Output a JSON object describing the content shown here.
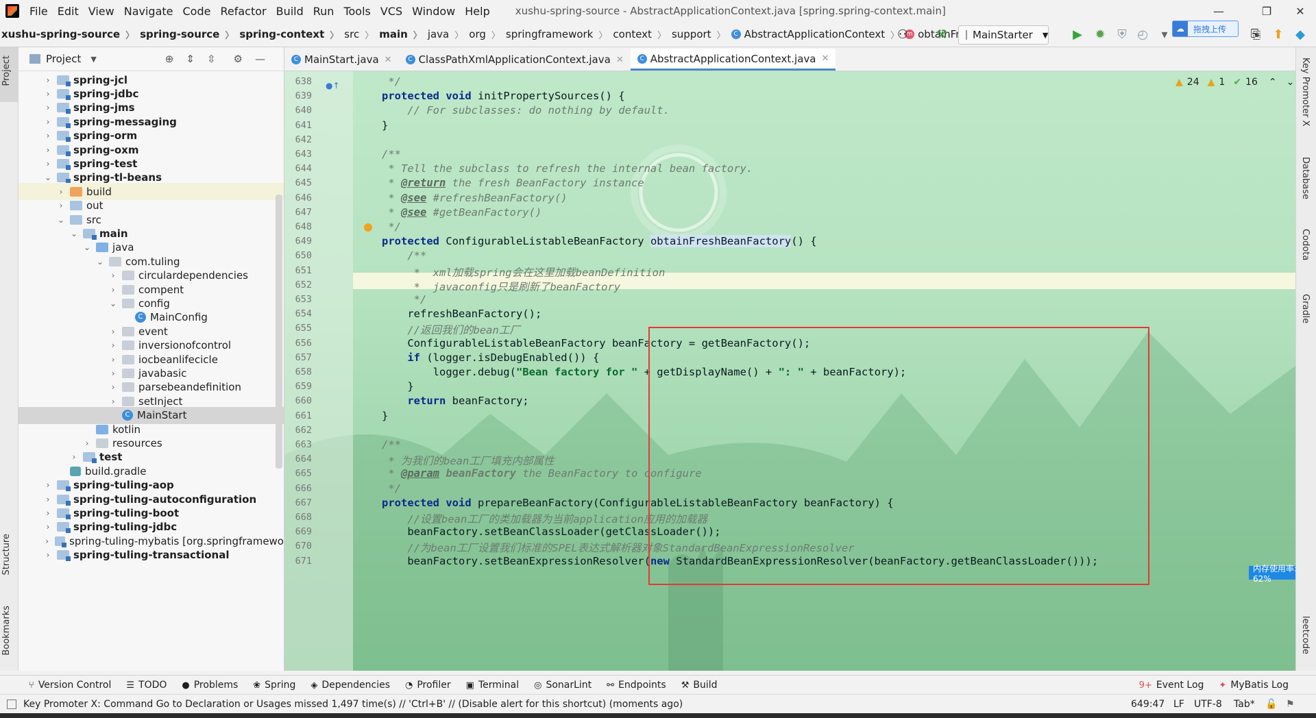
{
  "window": {
    "title": "xushu-spring-source - AbstractApplicationContext.java [spring.spring-context.main]",
    "menu": [
      "File",
      "Edit",
      "View",
      "Navigate",
      "Code",
      "Refactor",
      "Build",
      "Run",
      "Tools",
      "VCS",
      "Window",
      "Help"
    ],
    "menu_mnemonic": [
      "F",
      "E",
      "V",
      "N",
      "C",
      "R",
      "B",
      "R",
      "T",
      "V",
      "W",
      "H"
    ]
  },
  "breadcrumb": [
    {
      "label": "xushu-spring-source",
      "bold": true
    },
    {
      "label": "spring-source",
      "bold": true
    },
    {
      "label": "spring-context",
      "bold": true
    },
    {
      "label": "src",
      "bold": false
    },
    {
      "label": "main",
      "bold": true
    },
    {
      "label": "java",
      "bold": false
    },
    {
      "label": "org",
      "bold": false
    },
    {
      "label": "springframework",
      "bold": false
    },
    {
      "label": "context",
      "bold": false
    },
    {
      "label": "support",
      "bold": false
    },
    {
      "label": "AbstractApplicationContext",
      "bold": false
    },
    {
      "label": "obtainFreshBeanFactory",
      "bold": false
    }
  ],
  "toolbar": {
    "run_config": "MainStarter",
    "upload_badge": "拖拽上传"
  },
  "project": {
    "title": "Project",
    "tree": [
      {
        "label": "spring-jcl",
        "depth": 0,
        "chev": "right",
        "icon": "module",
        "bold": true
      },
      {
        "label": "spring-jdbc",
        "depth": 0,
        "chev": "right",
        "icon": "module",
        "bold": true
      },
      {
        "label": "spring-jms",
        "depth": 0,
        "chev": "right",
        "icon": "module",
        "bold": true
      },
      {
        "label": "spring-messaging",
        "depth": 0,
        "chev": "right",
        "icon": "module",
        "bold": true
      },
      {
        "label": "spring-orm",
        "depth": 0,
        "chev": "right",
        "icon": "module",
        "bold": true
      },
      {
        "label": "spring-oxm",
        "depth": 0,
        "chev": "right",
        "icon": "module",
        "bold": true
      },
      {
        "label": "spring-test",
        "depth": 0,
        "chev": "right",
        "icon": "module",
        "bold": true
      },
      {
        "label": "spring-tl-beans",
        "depth": 0,
        "chev": "down",
        "icon": "module",
        "bold": true
      },
      {
        "label": "build",
        "depth": 1,
        "chev": "right",
        "icon": "orange",
        "bold": false,
        "hl": true
      },
      {
        "label": "out",
        "depth": 1,
        "chev": "right",
        "icon": "folder",
        "bold": false
      },
      {
        "label": "src",
        "depth": 1,
        "chev": "down",
        "icon": "folder",
        "bold": false
      },
      {
        "label": "main",
        "depth": 2,
        "chev": "down",
        "icon": "module",
        "bold": true
      },
      {
        "label": "java",
        "depth": 3,
        "chev": "down",
        "icon": "blue",
        "bold": false
      },
      {
        "label": "com.tuling",
        "depth": 4,
        "chev": "down",
        "icon": "pkg",
        "bold": false
      },
      {
        "label": "circulardependencies",
        "depth": 5,
        "chev": "right",
        "icon": "pkg",
        "bold": false
      },
      {
        "label": "compent",
        "depth": 5,
        "chev": "right",
        "icon": "pkg",
        "bold": false
      },
      {
        "label": "config",
        "depth": 5,
        "chev": "down",
        "icon": "pkg",
        "bold": false
      },
      {
        "label": "MainConfig",
        "depth": 6,
        "chev": "none",
        "icon": "class",
        "bold": false
      },
      {
        "label": "event",
        "depth": 5,
        "chev": "right",
        "icon": "pkg",
        "bold": false
      },
      {
        "label": "inversionofcontrol",
        "depth": 5,
        "chev": "right",
        "icon": "pkg",
        "bold": false
      },
      {
        "label": "iocbeanlifecicle",
        "depth": 5,
        "chev": "right",
        "icon": "pkg",
        "bold": false
      },
      {
        "label": "javabasic",
        "depth": 5,
        "chev": "right",
        "icon": "pkg",
        "bold": false
      },
      {
        "label": "parsebeandefinition",
        "depth": 5,
        "chev": "right",
        "icon": "pkg",
        "bold": false
      },
      {
        "label": "setInject",
        "depth": 5,
        "chev": "right",
        "icon": "pkg",
        "bold": false
      },
      {
        "label": "MainStart",
        "depth": 5,
        "chev": "none",
        "icon": "class",
        "bold": false,
        "sel": true
      },
      {
        "label": "kotlin",
        "depth": 3,
        "chev": "none",
        "icon": "blue",
        "bold": false
      },
      {
        "label": "resources",
        "depth": 3,
        "chev": "right",
        "icon": "pkg",
        "bold": false
      },
      {
        "label": "test",
        "depth": 2,
        "chev": "right",
        "icon": "module",
        "bold": true
      },
      {
        "label": "build.gradle",
        "depth": 1,
        "chev": "none",
        "icon": "gradle",
        "bold": false
      },
      {
        "label": "spring-tuling-aop",
        "depth": 0,
        "chev": "right",
        "icon": "module",
        "bold": true
      },
      {
        "label": "spring-tuling-autoconfiguration",
        "depth": 0,
        "chev": "right",
        "icon": "module",
        "bold": true
      },
      {
        "label": "spring-tuling-boot",
        "depth": 0,
        "chev": "right",
        "icon": "module",
        "bold": true
      },
      {
        "label": "spring-tuling-jdbc",
        "depth": 0,
        "chev": "right",
        "icon": "module",
        "bold": true
      },
      {
        "label": "spring-tuling-mybatis [org.springframewo",
        "depth": 0,
        "chev": "right",
        "icon": "module",
        "bold": false
      },
      {
        "label": "spring-tuling-transactional",
        "depth": 0,
        "chev": "right",
        "icon": "module",
        "bold": true
      }
    ]
  },
  "tabs": [
    {
      "label": "MainStart.java",
      "active": false
    },
    {
      "label": "ClassPathXmlApplicationContext.java",
      "active": false
    },
    {
      "label": "AbstractApplicationContext.java",
      "active": true
    }
  ],
  "inspections": {
    "warnings": "24",
    "weak": "1",
    "ok": "16"
  },
  "code_lines": [
    {
      "n": "638",
      "html": "<span class='cm'> */</span>"
    },
    {
      "n": "639",
      "html": "<span class='kw'>protected void</span> initPropertySources() {"
    },
    {
      "n": "640",
      "html": "    <span class='cm'>// For subclasses: do nothing by default.</span>"
    },
    {
      "n": "641",
      "html": "}"
    },
    {
      "n": "642",
      "html": ""
    },
    {
      "n": "643",
      "html": "<span class='cm'>/**</span>"
    },
    {
      "n": "644",
      "html": "<span class='cm'> * Tell the subclass to refresh the internal bean factory.</span>"
    },
    {
      "n": "645",
      "html": "<span class='cm'> * </span><span class='tag'>@return</span><span class='cm'> the fresh BeanFactory instance</span>"
    },
    {
      "n": "646",
      "html": "<span class='cm'> * </span><span class='tag'>@see</span><span class='cm'> #refreshBeanFactory()</span>"
    },
    {
      "n": "647",
      "html": "<span class='cm'> * </span><span class='tag'>@see</span><span class='cm'> #getBeanFactory()</span>"
    },
    {
      "n": "648",
      "html": "<span class='cm'> */</span>"
    },
    {
      "n": "649",
      "html": "<span class='kw'>protected</span> ConfigurableListableBeanFactory <span class='fnhl'>obtainFreshBeanFactory</span>() {"
    },
    {
      "n": "650",
      "html": "    <span class='cm'>/**</span>"
    },
    {
      "n": "651",
      "html": "    <span class='cm'> *  xml加载spring会在这里加载beanDefinition</span>"
    },
    {
      "n": "652",
      "html": "    <span class='cm'> *  javaconfig只是刷新了beanFactory</span>"
    },
    {
      "n": "653",
      "html": "    <span class='cm'> */</span>"
    },
    {
      "n": "654",
      "html": "    refreshBeanFactory();"
    },
    {
      "n": "655",
      "html": "    <span class='cm'>//返回我们的bean工厂</span>"
    },
    {
      "n": "656",
      "html": "    ConfigurableListableBeanFactory beanFactory = getBeanFactory();"
    },
    {
      "n": "657",
      "html": "    <span class='kw'>if</span> (logger.isDebugEnabled()) {"
    },
    {
      "n": "658",
      "html": "        logger.debug(<span class='str'>\"Bean factory for \"</span> + getDisplayName() + <span class='str'>\": \"</span> + beanFactory);"
    },
    {
      "n": "659",
      "html": "    }"
    },
    {
      "n": "660",
      "html": "    <span class='kw'>return</span> beanFactory;"
    },
    {
      "n": "661",
      "html": "}"
    },
    {
      "n": "662",
      "html": ""
    },
    {
      "n": "663",
      "html": "<span class='cm'>/**</span>"
    },
    {
      "n": "664",
      "html": "<span class='cm'> * 为我们的bean工厂填充内部属性</span>"
    },
    {
      "n": "665",
      "html": "<span class='cm'> * </span><span class='tag'>@param</span><span class='cm'> <b>beanFactory</b> the BeanFactory to configure</span>"
    },
    {
      "n": "666",
      "html": "<span class='cm'> */</span>"
    },
    {
      "n": "667",
      "html": "<span class='kw'>protected void</span> prepareBeanFactory(ConfigurableListableBeanFactory beanFactory) {"
    },
    {
      "n": "668",
      "html": "    <span class='cm'>//设置bean工厂的类加载器为当前application应用的加载器</span>"
    },
    {
      "n": "669",
      "html": "    beanFactory.setBeanClassLoader(getClassLoader());"
    },
    {
      "n": "670",
      "html": "    <span class='cm'>//为bean工厂设置我们标准的SPEL表达式解析器对象StandardBeanExpressionResolver</span>"
    },
    {
      "n": "671",
      "html": "    beanFactory.setBeanExpressionResolver(<span class='kw'>new</span> StandardBeanExpressionResolver(beanFactory.getBeanClassLoader()));"
    }
  ],
  "memory_badge": "内存使用率: 62%",
  "left_strip": {
    "project": "Project",
    "structure": "Structure",
    "bookmarks": "Bookmarks"
  },
  "right_strip": {
    "key_promoter": "Key Promoter X",
    "database": "Database",
    "codota": "Codota",
    "gradle": "Gradle",
    "leetcode": "leetcode"
  },
  "bottom_tools": [
    {
      "label": "Version Control",
      "icon": "⑂"
    },
    {
      "label": "TODO",
      "icon": "☰"
    },
    {
      "label": "Problems",
      "icon": "●"
    },
    {
      "label": "Spring",
      "icon": "❀"
    },
    {
      "label": "Dependencies",
      "icon": "◈"
    },
    {
      "label": "Profiler",
      "icon": "◔"
    },
    {
      "label": "Terminal",
      "icon": "▣"
    },
    {
      "label": "SonarLint",
      "icon": "◎"
    },
    {
      "label": "Endpoints",
      "icon": "⚯"
    },
    {
      "label": "Build",
      "icon": "⚒"
    }
  ],
  "bottom_right_tools": [
    {
      "label": "Event Log",
      "icon": "9+"
    },
    {
      "label": "MyBatis Log",
      "icon": "✦"
    }
  ],
  "status": {
    "message": "Key Promoter X: Command Go to Declaration or Usages missed 1,497 time(s) // 'Ctrl+B' // (Disable alert for this shortcut) (moments ago)",
    "position": "649:47",
    "line_sep": "LF",
    "encoding": "UTF-8",
    "indent": "Tab*"
  }
}
